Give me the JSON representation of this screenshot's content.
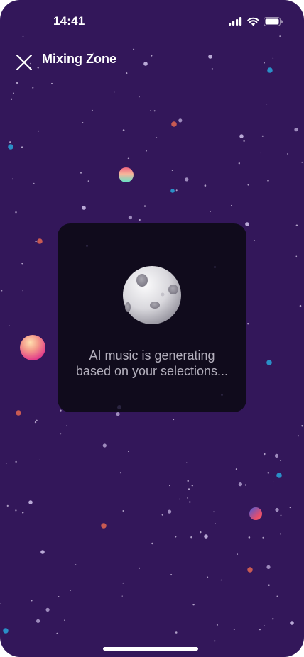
{
  "status_bar": {
    "time": "14:41",
    "icons": [
      "cellular-signal-icon",
      "wifi-icon",
      "battery-icon"
    ]
  },
  "header": {
    "close_icon": "close-icon",
    "title": "Mixing Zone"
  },
  "generation_card": {
    "illustration": "moon-icon",
    "message_line1": "AI music is generating",
    "message_line2": "based on your selections..."
  },
  "colors": {
    "background": "#33175a",
    "card": "#100b1c",
    "message_text": "#b4b0bd",
    "accent_blue": "#2a8fc7",
    "accent_orange": "#c85a52"
  }
}
